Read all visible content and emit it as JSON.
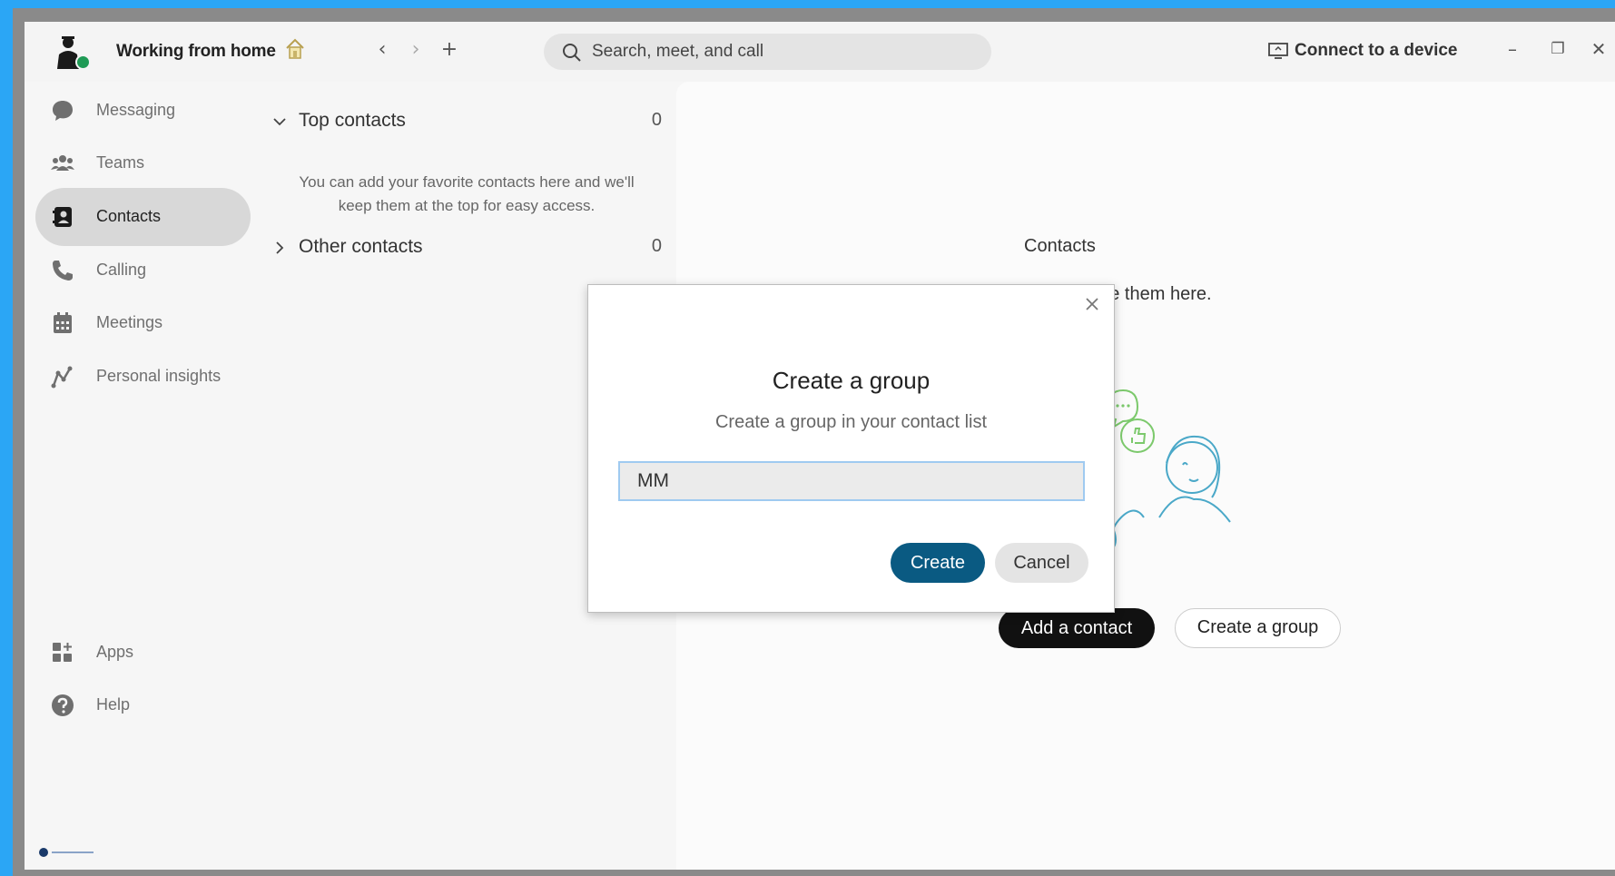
{
  "topbar": {
    "status_text": "Working from home",
    "search_placeholder": "Search, meet, and call",
    "connect_label": "Connect to a device",
    "nav_back": "‹",
    "nav_forward": "›",
    "nav_new": "+",
    "minimize": "–",
    "maximize": "❐",
    "close": "✕"
  },
  "sidebar": {
    "items": [
      {
        "label": "Messaging",
        "icon": "chat-bubble-icon"
      },
      {
        "label": "Teams",
        "icon": "team-icon"
      },
      {
        "label": "Contacts",
        "icon": "contacts-icon",
        "active": true
      },
      {
        "label": "Calling",
        "icon": "phone-icon"
      },
      {
        "label": "Meetings",
        "icon": "calendar-icon"
      },
      {
        "label": "Personal insights",
        "icon": "insights-icon"
      }
    ],
    "bottom_items": [
      {
        "label": "Apps",
        "icon": "apps-icon"
      },
      {
        "label": "Help",
        "icon": "help-icon"
      }
    ]
  },
  "contacts_panel": {
    "top_contacts": {
      "title": "Top contacts",
      "count": "0"
    },
    "top_contacts_help": "You can add your favorite contacts here and we'll keep them at the top for easy access.",
    "other_contacts": {
      "title": "Other contacts",
      "count": "0"
    }
  },
  "main": {
    "title": "Contacts",
    "description": "r contacts list and organize them here.",
    "add_contact_label": "Add a contact",
    "create_group_label": "Create a group"
  },
  "dialog": {
    "title": "Create a group",
    "subtitle": "Create a group in your contact list",
    "input_value": "MM",
    "create_label": "Create",
    "cancel_label": "Cancel"
  },
  "colors": {
    "screen_border": "#2ba6f5",
    "primary_button": "#0a5a82",
    "presence_available": "#1e9a55",
    "input_focus": "#9fcaf0",
    "illustration_green": "#7cc96c",
    "illustration_blue": "#4aa8c8"
  }
}
